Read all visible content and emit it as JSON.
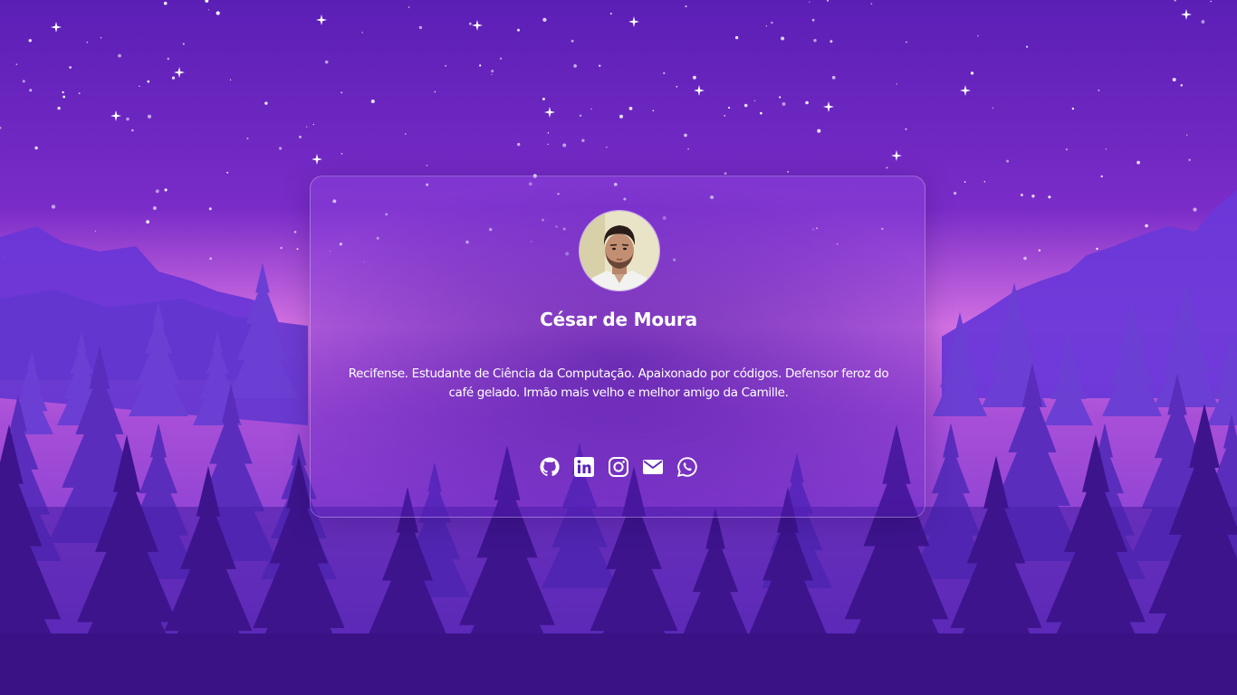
{
  "profile": {
    "name": "César de Moura",
    "bio": "Recifense. Estudante de Ciência da Computação. Apaixonado por códigos. Defensor feroz do café gelado. Irmão mais velho e melhor amigo da Camille."
  },
  "socials": [
    {
      "icon": "github-icon"
    },
    {
      "icon": "linkedin-icon"
    },
    {
      "icon": "instagram-icon"
    },
    {
      "icon": "mail-icon"
    },
    {
      "icon": "whatsapp-icon"
    }
  ],
  "colors": {
    "sky_top": "#5a1fb8",
    "sky_bottom": "#d06be0",
    "mountain": "#6a3ad8",
    "trees_far": "#6b3fd3",
    "trees_mid": "#5a2dbd",
    "trees_near": "#3d148c",
    "text": "#ffffff"
  }
}
